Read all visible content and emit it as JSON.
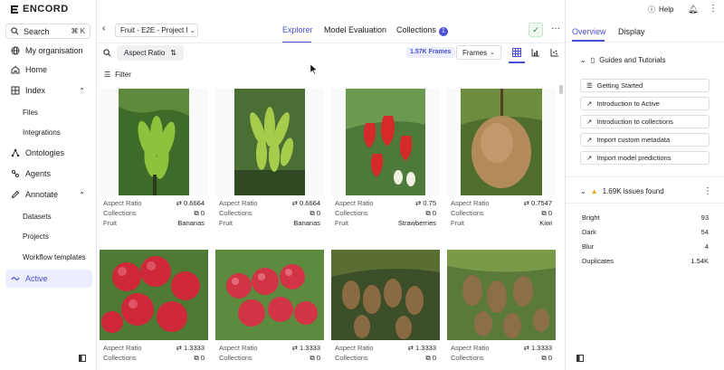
{
  "sidebar": {
    "logo": "ENCORD",
    "search_label": "Search",
    "search_shortcut": "⌘ K",
    "items": [
      {
        "label": "My organisation"
      },
      {
        "label": "Home"
      },
      {
        "label": "Index"
      },
      {
        "label": "Files"
      },
      {
        "label": "Integrations"
      },
      {
        "label": "Ontologies"
      },
      {
        "label": "Agents"
      },
      {
        "label": "Annotate"
      },
      {
        "label": "Datasets"
      },
      {
        "label": "Projects"
      },
      {
        "label": "Workflow templates"
      },
      {
        "label": "Active"
      }
    ]
  },
  "topbar": {
    "project": "Fruit - E2E - Project I",
    "tabs": [
      {
        "label": "Explorer"
      },
      {
        "label": "Model Evaluation"
      },
      {
        "label": "Collections"
      }
    ],
    "collections_count": "1"
  },
  "toolbar": {
    "sort_chip": "Aspect Ratio",
    "frames_count": "1.57K Frames",
    "frames_select": "Frames",
    "filter_label": "Filter"
  },
  "cards": [
    {
      "ar_label": "Aspect Ratio",
      "ar": "0.6664",
      "col_label": "Collections",
      "col": "0",
      "fruit_label": "Fruit",
      "fruit": "Bananas"
    },
    {
      "ar_label": "Aspect Ratio",
      "ar": "0.6664",
      "col_label": "Collections",
      "col": "0",
      "fruit_label": "Fruit",
      "fruit": "Bananas"
    },
    {
      "ar_label": "Aspect Ratio",
      "ar": "0.75",
      "col_label": "Collections",
      "col": "0",
      "fruit_label": "Fruit",
      "fruit": "Strawberries"
    },
    {
      "ar_label": "Aspect Ratio",
      "ar": "0.7547",
      "col_label": "Collections",
      "col": "0",
      "fruit_label": "Fruit",
      "fruit": "Kiwi"
    },
    {
      "ar_label": "Aspect Ratio",
      "ar": "1.3333",
      "col_label": "Collections",
      "col": "0"
    },
    {
      "ar_label": "Aspect Ratio",
      "ar": "1.3333",
      "col_label": "Collections",
      "col": "0"
    },
    {
      "ar_label": "Aspect Ratio",
      "ar": "1.3333",
      "col_label": "Collections",
      "col": "0"
    },
    {
      "ar_label": "Aspect Ratio",
      "ar": "1.3333",
      "col_label": "Collections",
      "col": "0"
    }
  ],
  "right": {
    "help": "Help",
    "tabs": [
      {
        "label": "Overview"
      },
      {
        "label": "Display"
      }
    ],
    "guides_title": "Guides and Tutorials",
    "guides": [
      {
        "label": "Getting Started"
      },
      {
        "label": "Introduction to Active"
      },
      {
        "label": "Introduction to collections"
      },
      {
        "label": "Import custom metadata"
      },
      {
        "label": "Import model predictions"
      }
    ],
    "issues_title": "1.69K issues found",
    "issues": [
      {
        "label": "Bright",
        "value": "93"
      },
      {
        "label": "Dark",
        "value": "54"
      },
      {
        "label": "Blur",
        "value": "4"
      },
      {
        "label": "Duplicates",
        "value": "1.54K"
      }
    ]
  },
  "colors": {
    "accent": "#4b4fd6"
  }
}
